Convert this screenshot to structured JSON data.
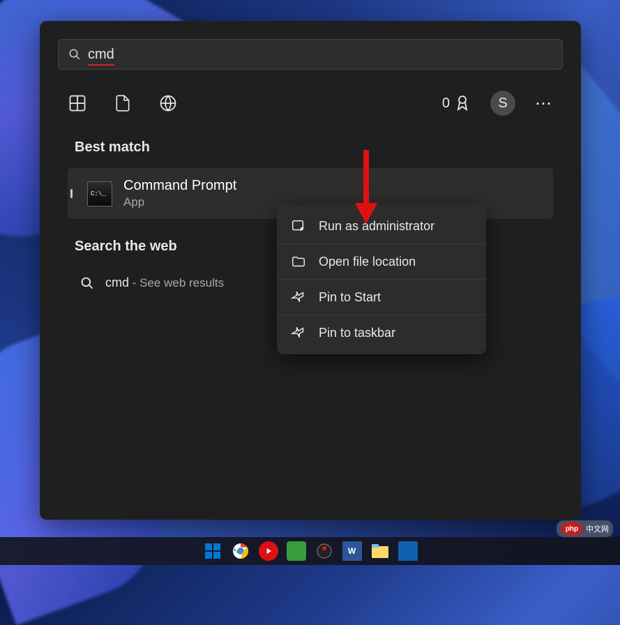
{
  "search": {
    "value": "cmd"
  },
  "rewards_count": "0",
  "avatar_initial": "S",
  "best_match": {
    "section_label": "Best match",
    "title": "Command Prompt",
    "subtitle": "App",
    "icon_text": "C:\\_"
  },
  "web": {
    "section_label": "Search the web",
    "query": "cmd",
    "sub": " - See web results"
  },
  "context_menu": [
    {
      "icon": "admin",
      "label": "Run as administrator"
    },
    {
      "icon": "folder",
      "label": "Open file location"
    },
    {
      "icon": "pin",
      "label": "Pin to Start"
    },
    {
      "icon": "pin",
      "label": "Pin to taskbar"
    }
  ],
  "watermark": {
    "badge": "php",
    "text": "中文网"
  }
}
